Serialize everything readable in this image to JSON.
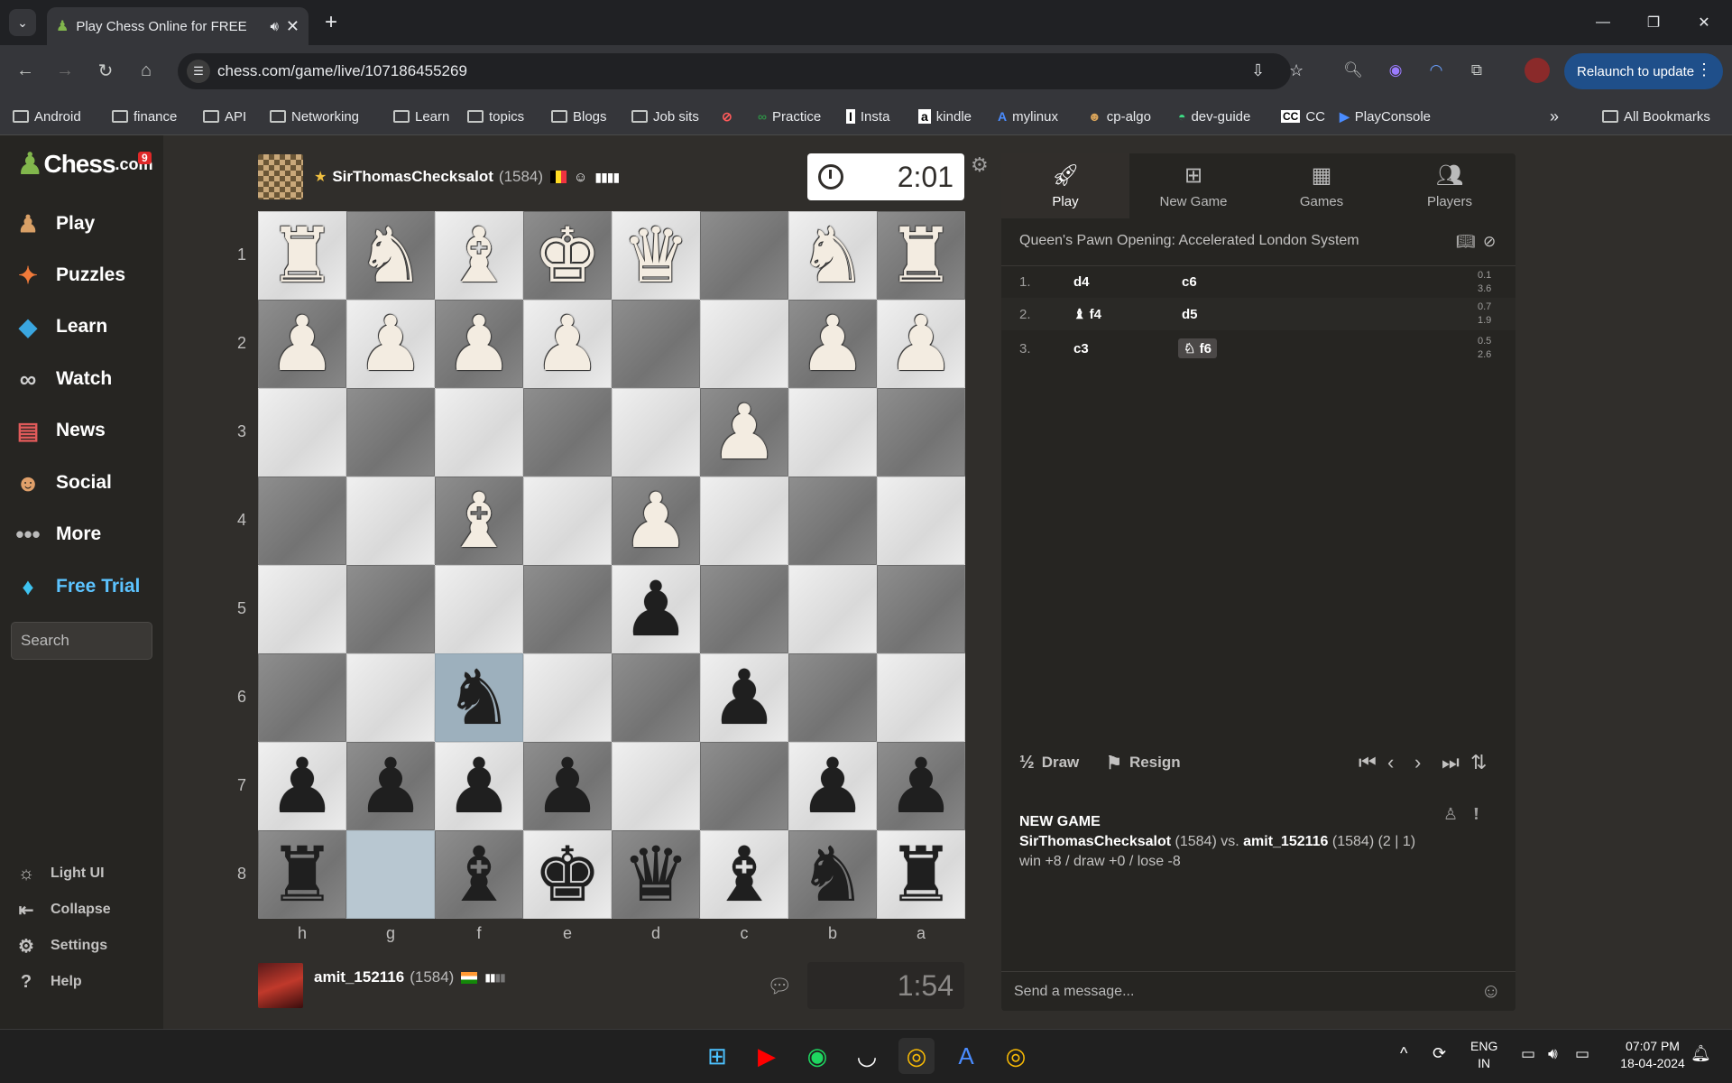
{
  "browser": {
    "tab_title": "Play Chess Online for FREE",
    "url": "chess.com/game/live/107186455269",
    "relaunch_label": "Relaunch to update",
    "bookmarks": [
      "Android",
      "finance",
      "API",
      "Networking",
      "Learn",
      "topics",
      "Blogs",
      "Job sits",
      "Practice",
      "Insta",
      "kindle",
      "mylinux",
      "cp-algo",
      "dev-guide",
      "CC",
      "PlayConsole"
    ],
    "all_bookmarks": "All Bookmarks"
  },
  "sidebar": {
    "logo_text": "Chess",
    "logo_suffix": ".com",
    "badge": "9",
    "items": [
      {
        "label": "Play",
        "icon": "play-pawn-icon"
      },
      {
        "label": "Puzzles",
        "icon": "puzzle-icon"
      },
      {
        "label": "Learn",
        "icon": "learn-icon"
      },
      {
        "label": "Watch",
        "icon": "binoculars-icon"
      },
      {
        "label": "News",
        "icon": "news-icon"
      },
      {
        "label": "Social",
        "icon": "social-icon"
      },
      {
        "label": "More",
        "icon": "more-dots-icon"
      },
      {
        "label": "Free Trial",
        "icon": "diamond-icon"
      }
    ],
    "search_placeholder": "Search",
    "bottom": [
      {
        "label": "Light UI",
        "icon": "sun-icon"
      },
      {
        "label": "Collapse",
        "icon": "collapse-icon"
      },
      {
        "label": "Settings",
        "icon": "gear-icon"
      },
      {
        "label": "Help",
        "icon": "help-icon"
      }
    ]
  },
  "game": {
    "top_player": {
      "name": "SirThomasChecksalot",
      "rating": "(1584)",
      "clock": "2:01"
    },
    "bottom_player": {
      "name": "amit_152116",
      "rating": "(1584)",
      "clock": "1:54"
    },
    "ranks": [
      "1",
      "2",
      "3",
      "4",
      "5",
      "6",
      "7",
      "8"
    ],
    "files": [
      "h",
      "g",
      "f",
      "e",
      "d",
      "c",
      "b",
      "a"
    ],
    "board": [
      [
        "wR",
        "wN",
        "wB",
        "wK",
        "wQ",
        "",
        "wN",
        "wR"
      ],
      [
        "wP",
        "wP",
        "wP",
        "wP",
        "",
        "",
        "wP",
        "wP"
      ],
      [
        "",
        "",
        "",
        "",
        "",
        "wP",
        "",
        ""
      ],
      [
        "",
        "",
        "wB",
        "",
        "wP",
        "",
        "",
        ""
      ],
      [
        "",
        "",
        "",
        "",
        "bP",
        "",
        "",
        ""
      ],
      [
        "",
        "",
        "bN",
        "",
        "",
        "bP",
        "",
        ""
      ],
      [
        "bP",
        "bP",
        "bP",
        "bP",
        "",
        "",
        "bP",
        "bP"
      ],
      [
        "bR",
        "",
        "bB",
        "bK",
        "bQ",
        "bB",
        "bN",
        "bR"
      ]
    ],
    "colors": {
      "light": "#d9d9d9",
      "dark": "#737373",
      "highlight": "#b8c7d1",
      "accent": "#81b64c"
    }
  },
  "panel": {
    "tabs": [
      "Play",
      "New Game",
      "Games",
      "Players"
    ],
    "opening": "Queen's Pawn Opening: Accelerated London System",
    "moves": [
      {
        "num": "1.",
        "white": "d4",
        "black": "c6",
        "wt": "0.1",
        "bt": "3.6"
      },
      {
        "num": "2.",
        "white": "f4",
        "black": "d5",
        "wt": "0.7",
        "bt": "1.9"
      },
      {
        "num": "3.",
        "white": "c3",
        "black": "f6",
        "wt": "0.5",
        "bt": "2.6"
      }
    ],
    "draw": "Draw",
    "draw_icon_text": "½",
    "resign": "Resign",
    "new_game_heading": "NEW GAME",
    "white_name": "SirThomasChecksalot",
    "white_rating": "(1584)",
    "vs": "vs.",
    "black_name": "amit_152116",
    "black_rating": "(1584)",
    "time_control": "(2 | 1)",
    "stakes": "win +8 / draw +0 / lose -8",
    "message_placeholder": "Send a message..."
  },
  "taskbar": {
    "lang_top": "ENG",
    "lang_bottom": "IN",
    "time": "07:07 PM",
    "date": "18-04-2024"
  }
}
